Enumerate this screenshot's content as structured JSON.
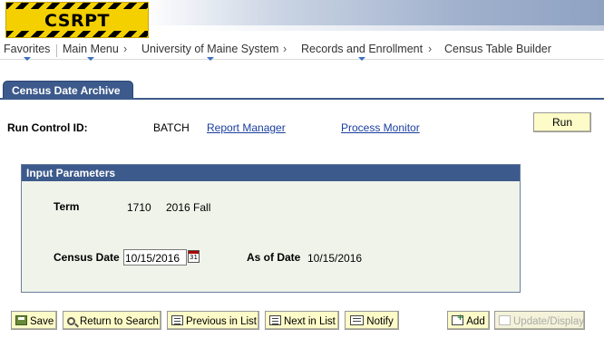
{
  "banner": {
    "logo_text": "CSRPT"
  },
  "nav": {
    "items": [
      "Favorites",
      "Main Menu",
      "University of Maine System",
      "Records and Enrollment",
      "Census Table Builder"
    ],
    "separator": "›"
  },
  "page": {
    "tab_label": "Census Date Archive"
  },
  "run_control": {
    "label": "Run Control ID:",
    "value": "BATCH",
    "report_manager": "Report Manager",
    "process_monitor": "Process Monitor",
    "run_button": "Run"
  },
  "input_params": {
    "title": "Input Parameters",
    "term_label": "Term",
    "term_code": "1710",
    "term_desc": "2016 Fall",
    "census_date_label": "Census Date",
    "census_date_value": "10/15/2016",
    "as_of_date_label": "As of Date",
    "as_of_date_value": "10/15/2016"
  },
  "toolbar": {
    "save": "Save",
    "return_to_search": "Return to Search",
    "previous_in_list": "Previous in List",
    "next_in_list": "Next in List",
    "notify": "Notify",
    "add": "Add",
    "update_display": "Update/Display"
  }
}
